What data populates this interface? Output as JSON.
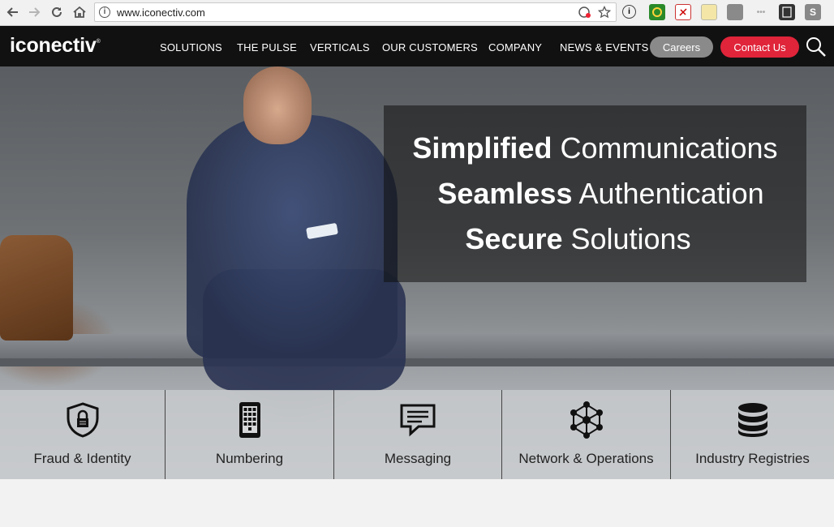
{
  "browser": {
    "url": "www.iconectiv.com",
    "back_icon": "arrow-left-icon",
    "forward_icon": "arrow-right-icon",
    "reload_icon": "reload-icon",
    "home_icon": "home-icon",
    "info_glyph": "i",
    "ext_s_glyph": "S"
  },
  "header": {
    "logo": "iconectiv",
    "logo_mark": "®",
    "nav": [
      "SOLUTIONS",
      "THE PULSE",
      "VERTICALS",
      "OUR CUSTOMERS",
      "COMPANY",
      "NEWS & EVENTS"
    ],
    "careers": "Careers",
    "contact": "Contact Us"
  },
  "hero": {
    "line1_bold": "Simplified",
    "line1_rest": " Communications",
    "line2_bold": "Seamless",
    "line2_rest": " Authentication",
    "line3_bold": "Secure",
    "line3_rest": " Solutions"
  },
  "categories": [
    {
      "label": "Fraud & Identity",
      "icon": "shield-lock-icon"
    },
    {
      "label": "Numbering",
      "icon": "keypad-phone-icon"
    },
    {
      "label": "Messaging",
      "icon": "chat-bubble-icon"
    },
    {
      "label": "Network & Operations",
      "icon": "network-icon"
    },
    {
      "label": "Industry Registries",
      "icon": "database-icon"
    }
  ],
  "colors": {
    "header_bg": "#111111",
    "careers_bg": "#8a8a8a",
    "contact_bg": "#e0243a"
  }
}
